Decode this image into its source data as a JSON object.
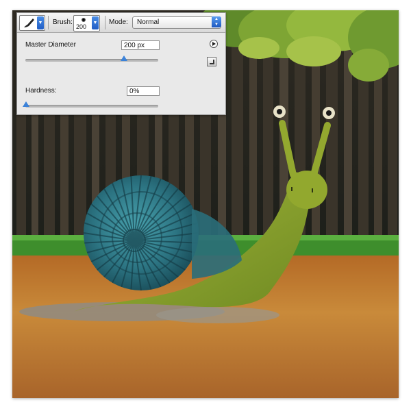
{
  "toolbar": {
    "brush_label": "Brush:",
    "brush_size": "200",
    "mode_label": "Mode:",
    "mode_value": "Normal",
    "tool_icon": "brush-icon"
  },
  "panel": {
    "master_diameter_label": "Master Diameter",
    "master_diameter_value": "200 px",
    "master_diameter_slider_fraction": 0.74,
    "hardness_label": "Hardness:",
    "hardness_value": "0%",
    "hardness_slider_fraction": 0.0
  },
  "colors": {
    "accent_blue": "#2a6fd6",
    "snail_body": "#8ba12c",
    "shell": "#2f7d86",
    "soil": "#c27a2e",
    "grass": "#3d8e2c",
    "trees_dark": "#2a2620",
    "foliage": "#8fb33a"
  }
}
